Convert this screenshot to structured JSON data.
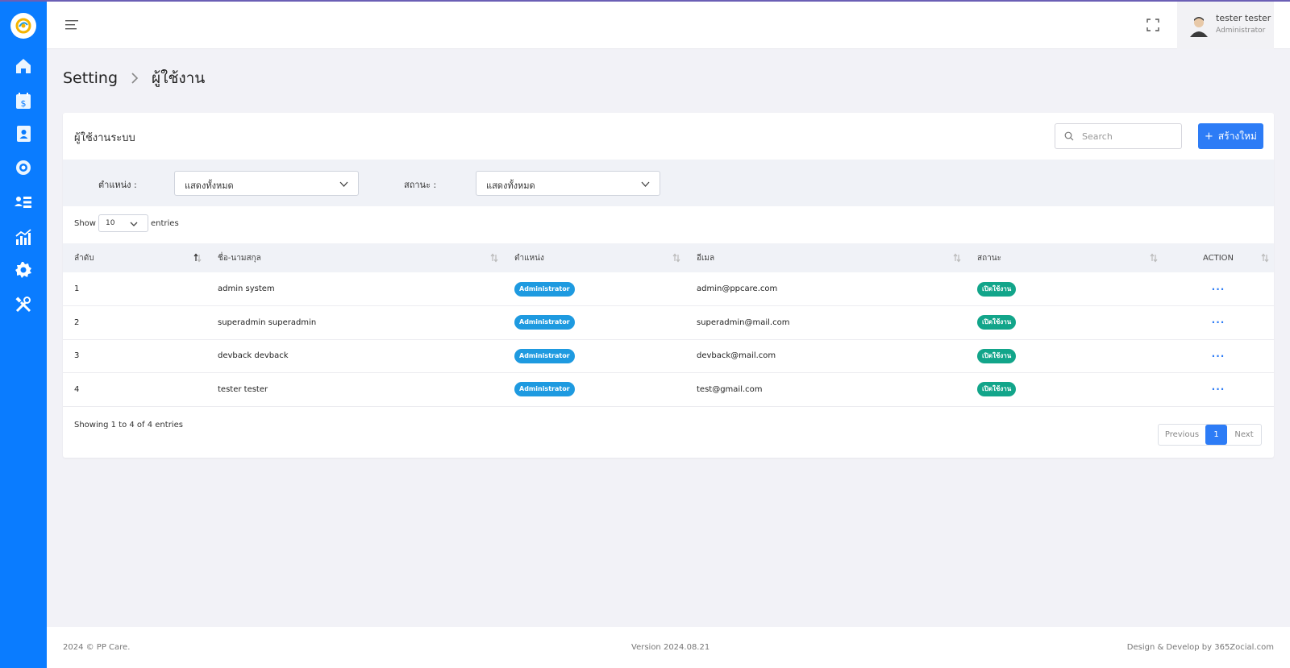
{
  "header": {
    "user_name": "tester tester",
    "user_role": "Administrator"
  },
  "breadcrumb": {
    "parent": "Setting",
    "current": "ผู้ใช้งาน"
  },
  "card": {
    "title": "ผู้ใช้งานระบบ",
    "search_placeholder": "Search",
    "create_label": "สร้างใหม่"
  },
  "filters": {
    "position_label": "ตำแหน่ง :",
    "position_value": "แสดงทั้งหมด",
    "status_label": "สถานะ :",
    "status_value": "แสดงทั้งหมด"
  },
  "length": {
    "show": "Show",
    "value": "10",
    "entries": "entries"
  },
  "table": {
    "columns": [
      "ลำดับ",
      "ชื่อ-นามสกุล",
      "ตำแหน่ง",
      "อีเมล",
      "สถานะ",
      "ACTION"
    ],
    "rows": [
      {
        "no": "1",
        "name": "admin system",
        "role": "Administrator",
        "email": "admin@ppcare.com",
        "status": "เปิดใช้งาน",
        "action": "···"
      },
      {
        "no": "2",
        "name": "superadmin superadmin",
        "role": "Administrator",
        "email": "superadmin@mail.com",
        "status": "เปิดใช้งาน",
        "action": "···"
      },
      {
        "no": "3",
        "name": "devback devback",
        "role": "Administrator",
        "email": "devback@mail.com",
        "status": "เปิดใช้งาน",
        "action": "···"
      },
      {
        "no": "4",
        "name": "tester tester",
        "role": "Administrator",
        "email": "test@gmail.com",
        "status": "เปิดใช้งาน",
        "action": "···"
      }
    ]
  },
  "info": "Showing 1 to 4 of 4 entries",
  "pagination": {
    "previous": "Previous",
    "current": "1",
    "next": "Next"
  },
  "footer": {
    "copyright": "2024 © PP Care.",
    "version": "Version 2024.08.21",
    "credit": "Design & Develop by 365Zocial.com"
  },
  "sidebar": {
    "icons": [
      "home-icon",
      "billing-calendar-icon",
      "contacts-icon",
      "team-settings-icon",
      "user-list-icon",
      "analytics-icon",
      "settings-icon",
      "tools-icon"
    ]
  },
  "colors": {
    "sidebar": "#0a7cff",
    "primary": "#2d7cf6",
    "role_badge": "#1e9ae0",
    "status_badge": "#12a58a"
  }
}
